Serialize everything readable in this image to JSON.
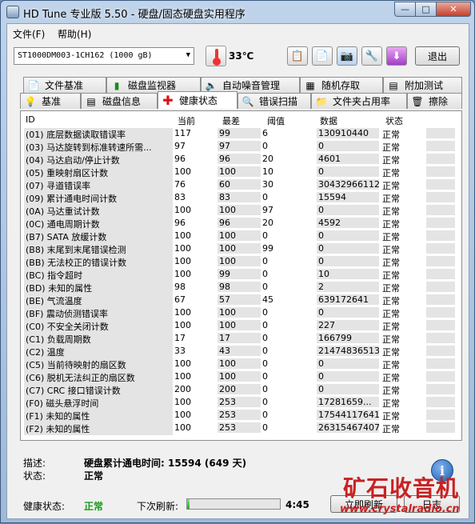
{
  "window": {
    "title": "HD Tune 专业版 5.50 - 硬盘/固态硬盘实用程序",
    "min": "—",
    "max": "□",
    "close": "✕"
  },
  "menu": {
    "file": "文件(F)",
    "help": "帮助(H)"
  },
  "toolbar": {
    "drive": "ST1000DM003-1CH162 (1000 gB)",
    "temperature": "33℃",
    "exit": "退出"
  },
  "tabs_top": [
    "文件基准",
    "磁盘监视器",
    "自动噪音管理",
    "随机存取",
    "附加测试"
  ],
  "tabs_bottom": [
    "基准",
    "磁盘信息",
    "健康状态",
    "错误扫描",
    "文件夹占用率",
    "擦除"
  ],
  "table": {
    "headers": {
      "id": "ID",
      "current": "当前",
      "worst": "最差",
      "threshold": "阈值",
      "data": "数据",
      "status": "状态"
    },
    "rows": [
      {
        "id": "(01) 底层数据读取错误率",
        "cur": "117",
        "worst": "99",
        "thr": "6",
        "data": "130910440",
        "stat": "正常"
      },
      {
        "id": "(03) 马达旋转到标准转速所需...",
        "cur": "97",
        "worst": "97",
        "thr": "0",
        "data": "0",
        "stat": "正常"
      },
      {
        "id": "(04) 马达启动/停止计数",
        "cur": "96",
        "worst": "96",
        "thr": "20",
        "data": "4601",
        "stat": "正常"
      },
      {
        "id": "(05) 重映射扇区计数",
        "cur": "100",
        "worst": "100",
        "thr": "10",
        "data": "0",
        "stat": "正常"
      },
      {
        "id": "(07) 寻道错误率",
        "cur": "76",
        "worst": "60",
        "thr": "30",
        "data": "30432966112",
        "stat": "正常"
      },
      {
        "id": "(09) 累计通电时间计数",
        "cur": "83",
        "worst": "83",
        "thr": "0",
        "data": "15594",
        "stat": "正常"
      },
      {
        "id": "(0A) 马达重试计数",
        "cur": "100",
        "worst": "100",
        "thr": "97",
        "data": "0",
        "stat": "正常"
      },
      {
        "id": "(0C) 通电周期计数",
        "cur": "96",
        "worst": "96",
        "thr": "20",
        "data": "4592",
        "stat": "正常"
      },
      {
        "id": "(B7) SATA 放缓计数",
        "cur": "100",
        "worst": "100",
        "thr": "0",
        "data": "0",
        "stat": "正常"
      },
      {
        "id": "(B8) 末尾到末尾错误检测",
        "cur": "100",
        "worst": "100",
        "thr": "99",
        "data": "0",
        "stat": "正常"
      },
      {
        "id": "(BB) 无法校正的错误计数",
        "cur": "100",
        "worst": "100",
        "thr": "0",
        "data": "0",
        "stat": "正常"
      },
      {
        "id": "(BC) 指令超时",
        "cur": "100",
        "worst": "99",
        "thr": "0",
        "data": "10",
        "stat": "正常"
      },
      {
        "id": "(BD) 未知的属性",
        "cur": "98",
        "worst": "98",
        "thr": "0",
        "data": "2",
        "stat": "正常"
      },
      {
        "id": "(BE) 气流温度",
        "cur": "67",
        "worst": "57",
        "thr": "45",
        "data": "639172641",
        "stat": "正常"
      },
      {
        "id": "(BF) 震动侦测错误率",
        "cur": "100",
        "worst": "100",
        "thr": "0",
        "data": "0",
        "stat": "正常"
      },
      {
        "id": "(C0) 不安全关闭计数",
        "cur": "100",
        "worst": "100",
        "thr": "0",
        "data": "227",
        "stat": "正常"
      },
      {
        "id": "(C1) 负载周期数",
        "cur": "17",
        "worst": "17",
        "thr": "0",
        "data": "166799",
        "stat": "正常"
      },
      {
        "id": "(C2) 温度",
        "cur": "33",
        "worst": "43",
        "thr": "0",
        "data": "21474836513",
        "stat": "正常"
      },
      {
        "id": "(C5) 当前待映射的扇区数",
        "cur": "100",
        "worst": "100",
        "thr": "0",
        "data": "0",
        "stat": "正常"
      },
      {
        "id": "(C6) 脱机无法纠正的扇区数",
        "cur": "100",
        "worst": "100",
        "thr": "0",
        "data": "0",
        "stat": "正常"
      },
      {
        "id": "(C7) CRC 接口错误计数",
        "cur": "200",
        "worst": "200",
        "thr": "0",
        "data": "0",
        "stat": "正常"
      },
      {
        "id": "(F0) 磁头悬浮时间",
        "cur": "100",
        "worst": "253",
        "thr": "0",
        "data": "17281659...",
        "stat": "正常"
      },
      {
        "id": "(F1) 未知的属性",
        "cur": "100",
        "worst": "253",
        "thr": "0",
        "data": "17544117641",
        "stat": "正常"
      },
      {
        "id": "(F2) 未知的属性",
        "cur": "100",
        "worst": "253",
        "thr": "0",
        "data": "26315467407",
        "stat": "正常"
      }
    ]
  },
  "details": {
    "desc_label": "描述:",
    "desc_value": "硬盘累计通电时间: 15594 (649 天)",
    "status_label": "状态:",
    "status_value": "正常"
  },
  "footer": {
    "health_label": "健康状态:",
    "health_value": "正常",
    "refresh_label": "下次刷新:",
    "refresh_time": "4:45",
    "refresh_progress": 0.03,
    "refresh_now": "立即刷新",
    "log": "日志"
  },
  "watermark": {
    "title": "矿石收音机",
    "url": "www.crystalradio.cn"
  },
  "colors": {
    "ok_green": "#1a9a1a",
    "watermark_red": "#c82222"
  }
}
